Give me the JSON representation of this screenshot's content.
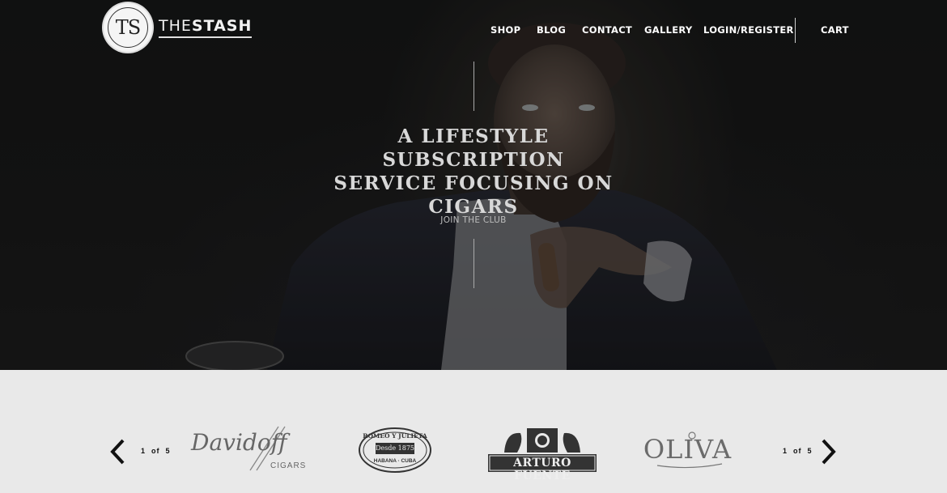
{
  "header": {
    "logo_monogram": "TS",
    "brand_prefix": "THE",
    "brand_suffix": "STASH",
    "nav": [
      "SHOP",
      "BLOG",
      "CONTACT",
      "GALLERY",
      "LOGIN/REGISTER"
    ],
    "cart_label": "CART"
  },
  "hero": {
    "headline_lines": [
      "A LIFESTYLE SUBSCRIPTION",
      "SERVICE FOCUSING ON",
      "CIGARS"
    ],
    "cta_label": "JOIN THE CLUB"
  },
  "brands": {
    "pager_left": {
      "current": "1",
      "of": "of",
      "total": "5"
    },
    "pager_right": {
      "current": "1",
      "of": "of",
      "total": "5"
    },
    "logos": [
      {
        "name": "Davidoff",
        "sub": "CIGARS"
      },
      {
        "name": "ROMEO Y JULIETA",
        "mid": "Desde 1875",
        "sub": "HABANA · CUBA"
      },
      {
        "name": "ARTURO FUENTE"
      },
      {
        "name": "OLIVA"
      }
    ]
  },
  "colors": {
    "hero_bg": "#131414",
    "strip_bg": "#e9e9e9",
    "nav_text": "#ffffff"
  }
}
